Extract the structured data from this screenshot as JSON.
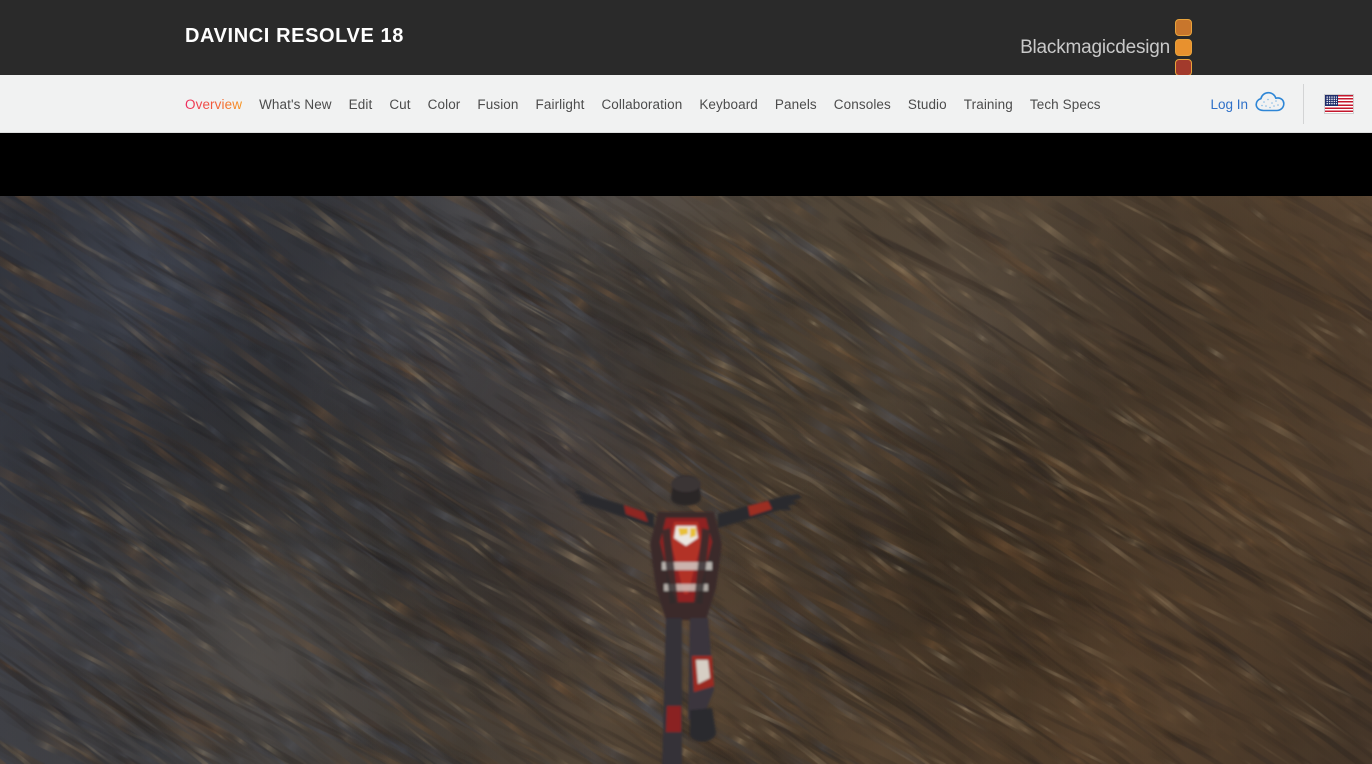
{
  "brandbar": {
    "product_title": "DAVINCI RESOLVE 18",
    "logo": {
      "wordmark": "Blackmagicdesign",
      "square_colors": [
        "#c8762c",
        "#e8912e",
        "#a23a2c"
      ],
      "square_border": "#e8a33c"
    },
    "background": "#2a2a2a"
  },
  "nav": {
    "items": [
      {
        "label": "Overview",
        "active": true
      },
      {
        "label": "What's New",
        "active": false
      },
      {
        "label": "Edit",
        "active": false
      },
      {
        "label": "Cut",
        "active": false
      },
      {
        "label": "Color",
        "active": false
      },
      {
        "label": "Fusion",
        "active": false
      },
      {
        "label": "Fairlight",
        "active": false
      },
      {
        "label": "Collaboration",
        "active": false
      },
      {
        "label": "Keyboard",
        "active": false
      },
      {
        "label": "Panels",
        "active": false
      },
      {
        "label": "Consoles",
        "active": false
      },
      {
        "label": "Studio",
        "active": false
      },
      {
        "label": "Training",
        "active": false
      },
      {
        "label": "Tech Specs",
        "active": false
      }
    ],
    "login_label": "Log In",
    "login_icon": "cloud-icon",
    "language_flag": "us-flag-icon",
    "active_color": "#f05a3c",
    "link_color": "#4c4c4c",
    "login_color": "#2e70c8",
    "background": "#f1f2f2"
  },
  "hero": {
    "letterbox_color": "#000000",
    "alt": "wingsuit skydiver with arms outstretched over motion-blurred autumn terrain",
    "palette": {
      "left_cool": "#4e5463",
      "mid_warm": "#6e5c46",
      "right_warm": "#7a5f44",
      "highlight": "#b79a72",
      "shadow": "#2e2a26",
      "suit_red": "#9e2a26",
      "suit_dark": "#2b2b2f",
      "suit_white": "#e8e4df"
    }
  }
}
